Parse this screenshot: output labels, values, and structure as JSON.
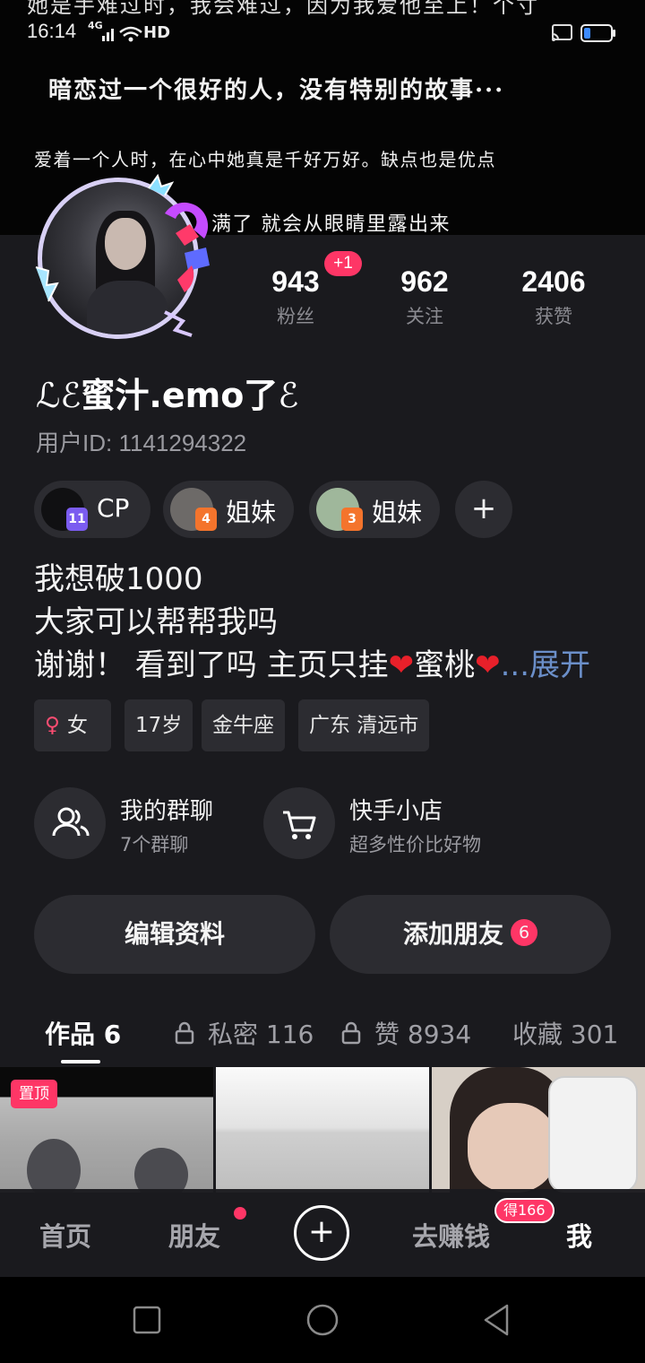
{
  "status_bar": {
    "cut_off_text": "她是手难过时，我会难过，因为我爱他至上！个寸",
    "time": "16:14",
    "network": "4G",
    "hd": "HD"
  },
  "banner": {
    "line1": "暗恋过一个很好的人，没有特别的故事···",
    "line2": "爱着一个人时，在心中她真是千好万好。缺点也是优点",
    "line3": "满了 就会从眼睛里露出来"
  },
  "profile": {
    "stats": [
      {
        "value": "943",
        "label": "粉丝"
      },
      {
        "value": "962",
        "label": "关注"
      },
      {
        "value": "2406",
        "label": "获赞"
      }
    ],
    "fans_badge": "+1",
    "nickname_left_deco": "ℒℰ",
    "nickname": "蜜汁.emo了",
    "nickname_right_deco": "ℰ",
    "user_id": "用户ID: 1141294322"
  },
  "relations": [
    {
      "label": "CP",
      "level": "11",
      "level_color": "#7b5cf0"
    },
    {
      "label": "姐妹",
      "level": "4",
      "level_color": "#f4742c"
    },
    {
      "label": "姐妹",
      "level": "3",
      "level_color": "#f4742c"
    }
  ],
  "bio": {
    "line1": "我想破1000",
    "line2": "大家可以帮帮我吗",
    "line3_a": "谢谢！ 看到了吗 主页只挂",
    "heart": "❤",
    "line3_b": "蜜桃",
    "expand": "...展开"
  },
  "tags": {
    "gender_symbol": "♀",
    "gender": "女",
    "age": "17岁",
    "zodiac": "金牛座",
    "location": "广东 清远市"
  },
  "shortcuts": {
    "group_title": "我的群聊",
    "group_sub": "7个群聊",
    "shop_title": "快手小店",
    "shop_sub": "超多性价比好物"
  },
  "buttons": {
    "edit_profile": "编辑资料",
    "add_friend": "添加朋友",
    "add_friend_count": "6"
  },
  "tabs": [
    {
      "label": "作品 6"
    },
    {
      "label": "私密 116"
    },
    {
      "label": "赞 8934"
    },
    {
      "label": "收藏 301"
    }
  ],
  "thumbnails": {
    "pin_label": "置顶"
  },
  "bottom_nav": {
    "home": "首页",
    "friends": "朋友",
    "plus": "+",
    "earn": "去赚钱",
    "earn_badge": "得166",
    "me": "我"
  },
  "colors": {
    "accent": "#fe3666",
    "panel_bg": "#1a1a1e",
    "chip_bg": "#2c2c31"
  }
}
